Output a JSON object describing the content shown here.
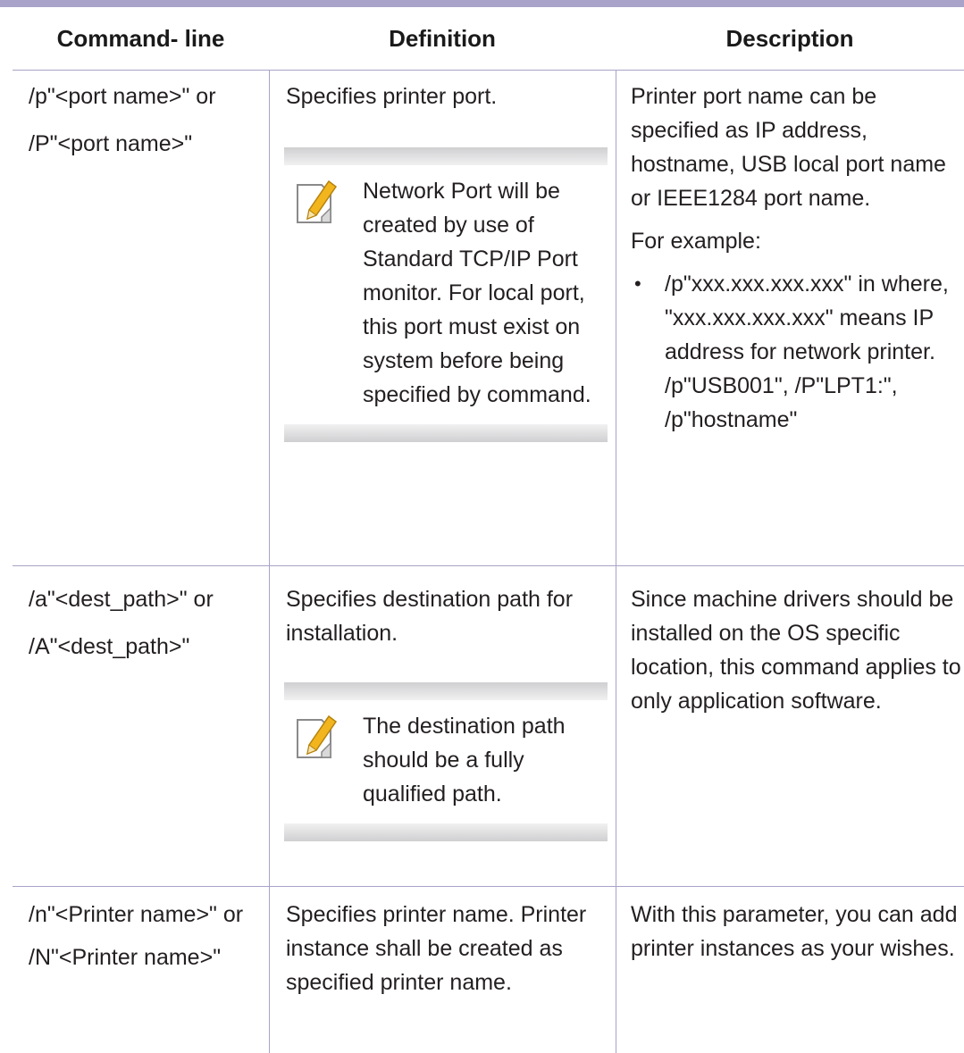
{
  "header": {
    "col1": "Command- line",
    "col2": "Definition",
    "col3": "Description"
  },
  "rows": [
    {
      "command": [
        "/p\"<port name>\" or",
        "/P\"<port name>\""
      ],
      "definition": "Specifies printer port.",
      "note": "Network Port will be created by use of Standard TCP/IP Port monitor. For local port, this port must exist on system before being specified by command.",
      "description": "Printer port name can be specified as IP address, hostname, USB local port name or IEEE1284 port name.",
      "example_label": "For example:",
      "bullet": "/p\"xxx.xxx.xxx.xxx\" in where, \"xxx.xxx.xxx.xxx\" means IP address for network printer. /p\"USB001\", /P\"LPT1:\", /p\"hostname\""
    },
    {
      "command": [
        "/a\"<dest_path>\" or",
        "/A\"<dest_path>\""
      ],
      "definition": "Specifies destination path for installation.",
      "note": "The destination path should be a fully qualified path.",
      "description": "Since machine drivers should be installed on the OS specific location, this command applies to only application software."
    },
    {
      "command": [
        "/n\"<Printer name>\" or",
        "/N\"<Printer name>\""
      ],
      "definition": "Specifies printer name. Printer instance shall be created as specified printer name.",
      "description": "With this parameter, you can add printer instances as your wishes."
    }
  ],
  "icons": {
    "note": "note-pencil-icon"
  },
  "colors": {
    "rule": "#a9a3c9",
    "text": "#231f20",
    "note_icon": "#f2b51e"
  }
}
